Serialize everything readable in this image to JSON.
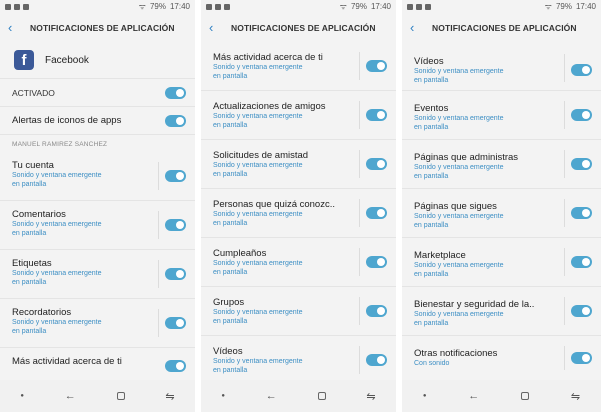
{
  "status": {
    "battery": "79%",
    "time": "17:40"
  },
  "header": {
    "back": "‹",
    "title": "NOTIFICACIONES DE APLICACIÓN"
  },
  "panel0": {
    "app_name": "Facebook",
    "activated": "ACTIVADO",
    "badges": "Alertas de iconos de apps",
    "section": "MANUEL RAMIREZ SANCHEZ",
    "items": [
      {
        "label": "Tu cuenta",
        "sub1": "Sonido y ventana emergente",
        "sub2": "en pantalla"
      },
      {
        "label": "Comentarios",
        "sub1": "Sonido y ventana emergente",
        "sub2": "en pantalla"
      },
      {
        "label": "Etiquetas",
        "sub1": "Sonido y ventana emergente",
        "sub2": "en pantalla"
      },
      {
        "label": "Recordatorios",
        "sub1": "Sonido y ventana emergente",
        "sub2": "en pantalla"
      },
      {
        "label": "Más actividad acerca de ti",
        "sub1": "",
        "sub2": ""
      }
    ]
  },
  "panel1": {
    "items": [
      {
        "label": "Más actividad acerca de ti",
        "sub1": "Sonido y ventana emergente",
        "sub2": "en pantalla"
      },
      {
        "label": "Actualizaciones de amigos",
        "sub1": "Sonido y ventana emergente",
        "sub2": "en pantalla"
      },
      {
        "label": "Solicitudes de amistad",
        "sub1": "Sonido y ventana emergente",
        "sub2": "en pantalla"
      },
      {
        "label": "Personas que quizá conozc..",
        "sub1": "Sonido y ventana emergente",
        "sub2": "en pantalla"
      },
      {
        "label": "Cumpleaños",
        "sub1": "Sonido y ventana emergente",
        "sub2": "en pantalla"
      },
      {
        "label": "Grupos",
        "sub1": "Sonido y ventana emergente",
        "sub2": "en pantalla"
      },
      {
        "label": "Vídeos",
        "sub1": "Sonido y ventana emergente",
        "sub2": "en pantalla"
      }
    ]
  },
  "panel2": {
    "items": [
      {
        "label": "Vídeos",
        "sub1": "Sonido y ventana emergente",
        "sub2": "en pantalla"
      },
      {
        "label": "Eventos",
        "sub1": "Sonido y ventana emergente",
        "sub2": "en pantalla"
      },
      {
        "label": "Páginas que administras",
        "sub1": "Sonido y ventana emergente",
        "sub2": "en pantalla"
      },
      {
        "label": "Páginas que sigues",
        "sub1": "Sonido y ventana emergente",
        "sub2": "en pantalla"
      },
      {
        "label": "Marketplace",
        "sub1": "Sonido y ventana emergente",
        "sub2": "en pantalla"
      },
      {
        "label": "Bienestar y seguridad de la..",
        "sub1": "Sonido y ventana emergente",
        "sub2": "en pantalla"
      },
      {
        "label": "Otras notificaciones",
        "sub1": "Con sonido",
        "sub2": ""
      }
    ]
  },
  "nav": {
    "back": "←",
    "recents": "⇋"
  },
  "colors": {
    "accent": "#4ea6cf",
    "link": "#2d7fc2",
    "facebook": "#3b5998"
  }
}
